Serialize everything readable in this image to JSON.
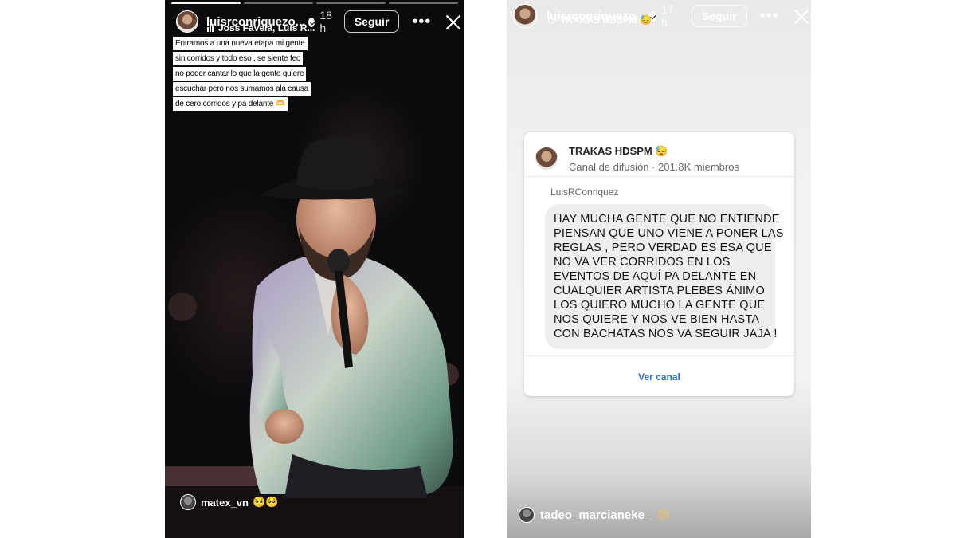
{
  "story_left": {
    "progress": {
      "segments": 4,
      "completed": 1
    },
    "username": "luisrconriquezo...",
    "time": "18 h",
    "follow_label": "Seguir",
    "more_icon": "more-dots-icon",
    "close_icon": "close-icon",
    "music": "Joss Favela, Luis R...",
    "caption_lines": [
      "Entramos a una nueva etapa mi gente",
      "sin corridos y todo eso , se siente feo",
      "no poder cantar lo que la gente quiere",
      "escuchar pero nos sumamos ala causa",
      "de cero corridos y pa delante 🫶"
    ],
    "mention": {
      "name": "matex_vn",
      "emoji": "🥺🥺"
    }
  },
  "story_right": {
    "username": "luisrconriquezo...",
    "time": "17 h",
    "follow_label": "Seguir",
    "subtitle": "TRAKAS HDSPM 😓",
    "card": {
      "channel_name": "TRAKAS HDSPM 😓",
      "channel_type": "Canal de difusión",
      "separator": "·",
      "members": "201.8K miembros",
      "sender": "LuisRConriquez",
      "message_lines": [
        "HAY MUCHA GENTE QUE NO ENTIENDE",
        "PIENSAN QUE UNO VIENE A PONER LAS",
        "REGLAS , PERO VERDAD ES ESA QUE",
        "NO VA VER CORRIDOS EN LOS",
        "EVENTOS DE AQUÍ PA DELANTE EN",
        "CUALQUIER ARTISTA PLEBES ÁNIMO",
        "LOS QUIERO MUCHO LA GENTE QUE",
        "NOS QUIERE Y NOS VE BIEN HASTA",
        "CON BACHATAS NOS VA SEGUIR JAJA !"
      ],
      "view_label": "Ver canal"
    },
    "mention": {
      "name": "tadeo_marcianeke_",
      "emoji": "😔"
    }
  },
  "colors": {
    "link": "#2a6fd6",
    "bubble": "#eeeeee",
    "card": "#ffffff"
  }
}
